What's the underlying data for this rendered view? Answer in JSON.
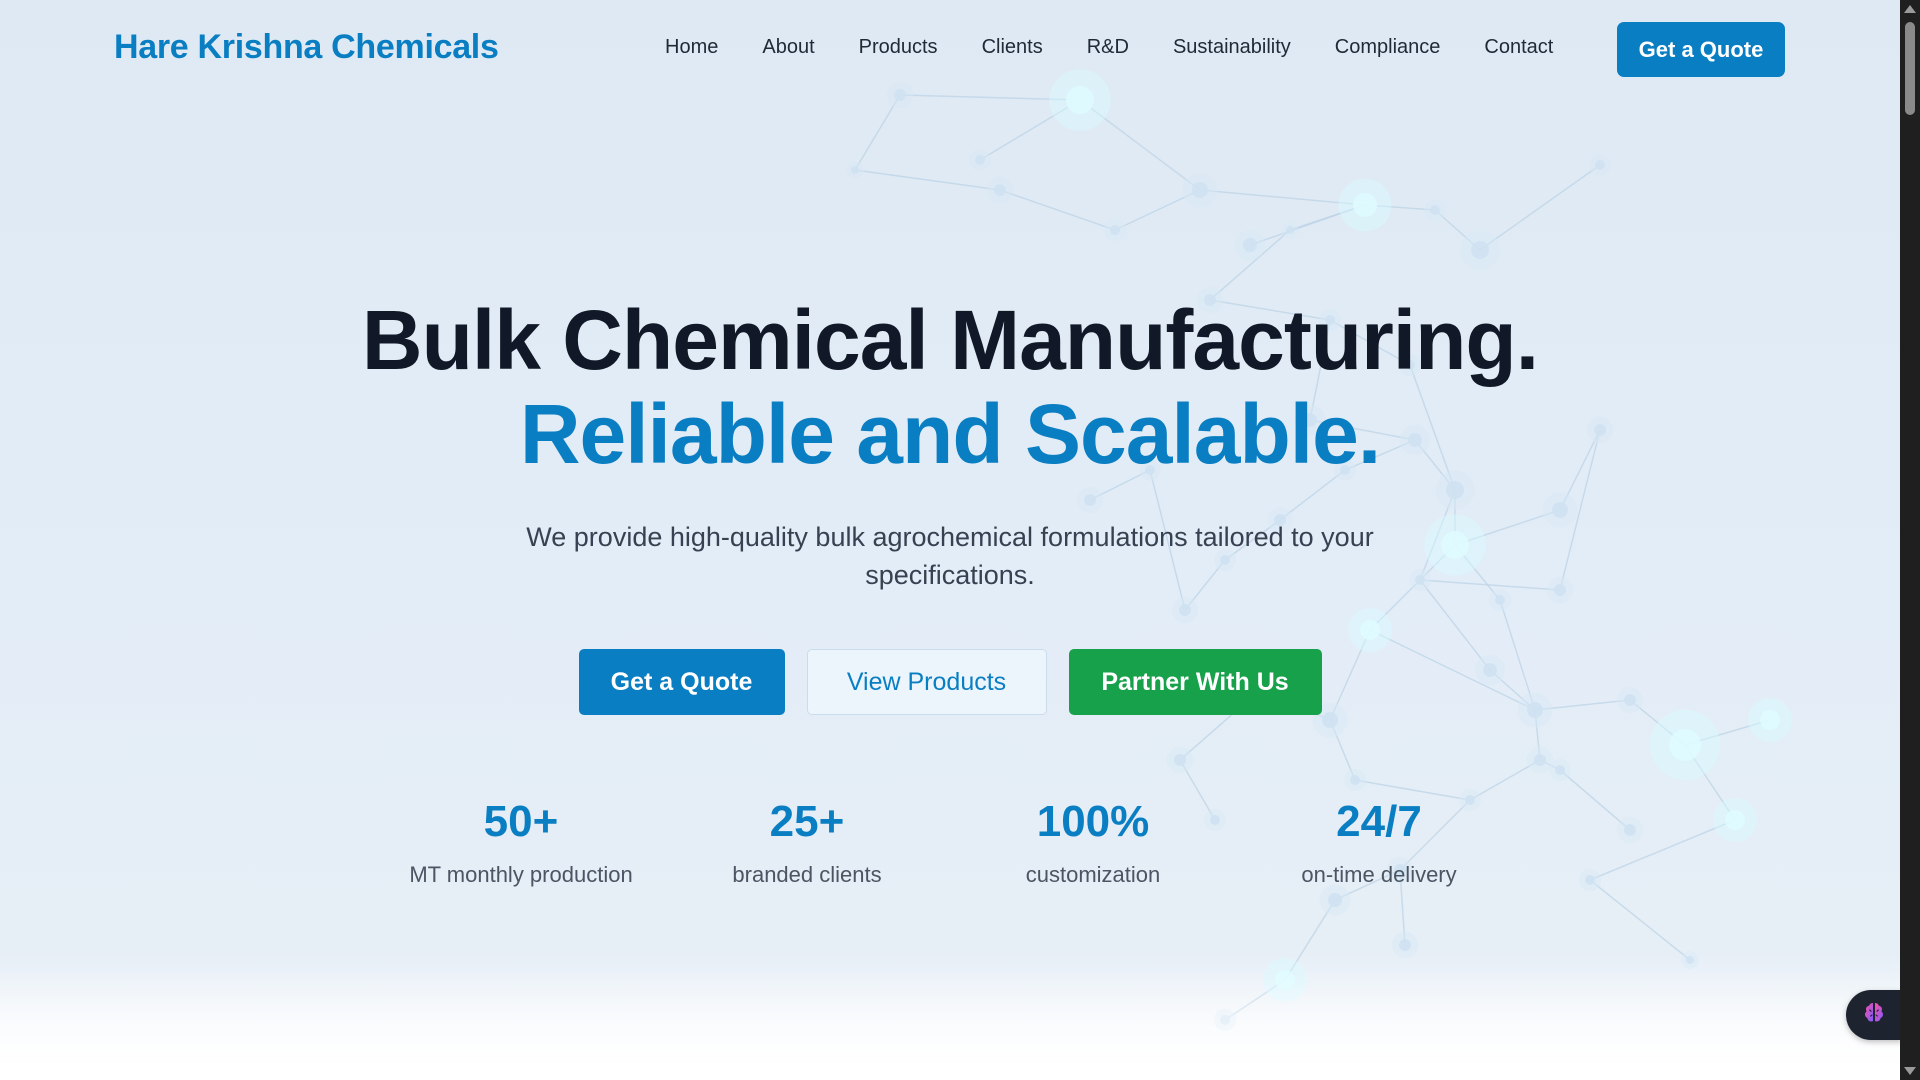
{
  "brand": {
    "name": "Hare Krishna Chemicals"
  },
  "nav": {
    "items": [
      "Home",
      "About",
      "Products",
      "Clients",
      "R&D",
      "Sustainability",
      "Compliance",
      "Contact"
    ],
    "cta_label": "Get a Quote"
  },
  "hero": {
    "headline_line1": "Bulk Chemical Manufacturing.",
    "headline_line2": "Reliable and Scalable.",
    "subheading": "We provide high-quality bulk agrochemical formulations tailored to your specifications.",
    "buttons": {
      "quote": "Get a Quote",
      "products": "View Products",
      "partner": "Partner With Us"
    }
  },
  "stats": [
    {
      "value": "50+",
      "label": "MT monthly production"
    },
    {
      "value": "25+",
      "label": "branded clients"
    },
    {
      "value": "100%",
      "label": "customization"
    },
    {
      "value": "24/7",
      "label": "on-time delivery"
    }
  ],
  "colors": {
    "accent": "#0a7ec2",
    "headline": "#111827",
    "partner_green": "#17a14a",
    "background": "#e0eaf4"
  },
  "icons": {
    "floating_widget": "brain-icon"
  }
}
